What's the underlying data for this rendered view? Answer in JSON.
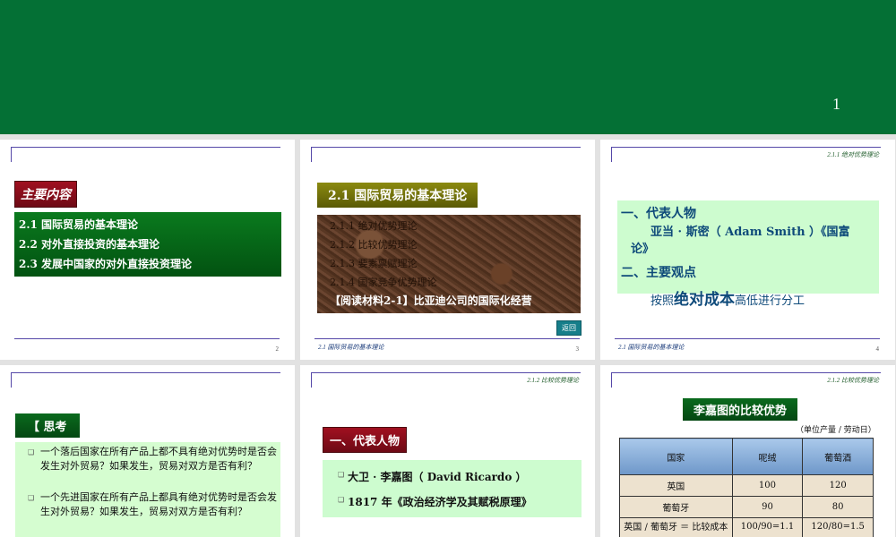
{
  "banner": {
    "page_number": "1"
  },
  "slide2": {
    "title": "主要内容",
    "items": [
      "2.1 国际贸易的基本理论",
      "2.2 对外直接投资的基本理论",
      "2.3 发展中国家的对外直接投资理论"
    ],
    "page": "2"
  },
  "slide3": {
    "title": "2.1 国际贸易的基本理论",
    "items": [
      "2.1.1 绝对优势理论",
      "2.1.2 比较优势理论",
      "2.1.3 要素禀赋理论",
      "2.1.4 国家竞争优势理论"
    ],
    "reading": "【阅读材料2-1】比亚迪公司的国际化经营",
    "back": "返回",
    "footer": "2.1 国际贸易的基本理论",
    "page": "3"
  },
  "slide4": {
    "tag": "2.1.1 绝对优势理论",
    "heading1": "一、代表人物",
    "person": "亚当 · 斯密（ Adam Smith ）《国富论》",
    "heading2": "二、主要观点",
    "view_pre": "按照",
    "view_em": "绝对成本",
    "view_post": "高低进行分工",
    "footer": "2.1 国际贸易的基本理论",
    "page": "4"
  },
  "slide5": {
    "title": "【 思考",
    "q1": "一个落后国家在所有产品上都不具有绝对优势时是否会发生对外贸易？如果发生，贸易对双方是否有利？",
    "q2": "一个先进国家在所有产品上都具有绝对优势时是否会发生对外贸易？如果发生，贸易对双方是否有利？"
  },
  "slide6": {
    "tag": "2.1.2 比较优势理论",
    "title": "一、代表人物",
    "item1": "大卫 · 李嘉图（ David Ricardo ）",
    "item2": "1817 年《政治经济学及其赋税原理》"
  },
  "slide7": {
    "tag": "2.1.2 比较优势理论",
    "title": "李嘉图的比较优势",
    "unit": "（单位产量 / 劳动日）",
    "headers": [
      "国家",
      "呢绒",
      "葡萄酒"
    ],
    "rows": [
      [
        "英国",
        "100",
        "120"
      ],
      [
        "葡萄牙",
        "90",
        "80"
      ],
      [
        "英国 / 葡萄牙 ＝ 比较成本",
        "100/90=1.1",
        "120/80=1.5"
      ]
    ]
  }
}
